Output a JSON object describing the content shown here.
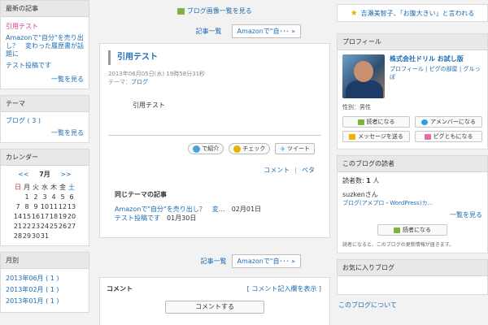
{
  "left": {
    "recent": {
      "header": "最新の記事",
      "items": [
        {
          "label": "引用テスト",
          "active": true
        },
        {
          "label": "Amazonで\"自分\"を売り出し？　変わった履歴書が話題に",
          "active": false
        },
        {
          "label": "テスト投稿です",
          "active": false
        }
      ],
      "more": "一覧を見る"
    },
    "theme": {
      "header": "テーマ",
      "item": "ブログ ( 3 )",
      "more": "一覧を見る"
    },
    "calendar": {
      "header": "カレンダー",
      "prev": "<<",
      "month": "7月",
      "next": ">>",
      "weekdays": [
        "日",
        "月",
        "火",
        "水",
        "木",
        "金",
        "土"
      ],
      "rows": [
        [
          "",
          "1",
          "2",
          "3",
          "4",
          "5",
          "6"
        ],
        [
          "7",
          "8",
          "9",
          "10",
          "11",
          "12",
          "13"
        ],
        [
          "14",
          "15",
          "16",
          "17",
          "18",
          "19",
          "20"
        ],
        [
          "21",
          "22",
          "23",
          "24",
          "25",
          "26",
          "27"
        ],
        [
          "28",
          "29",
          "30",
          "31",
          "",
          "",
          ""
        ]
      ]
    },
    "monthly": {
      "header": "月別",
      "items": [
        "2013年06月 ( 1 )",
        "2013年02月 ( 1 )",
        "2013年01月 ( 1 )"
      ]
    }
  },
  "center": {
    "top_link": "ブログ画像一覧を見る",
    "pager": {
      "list": "記事一覧",
      "next": "Amazonで\"自･･･ »"
    },
    "article": {
      "title": "引用テスト",
      "date": "2013年06月05日(水) 19時58分31秒",
      "theme_label": "テーマ：",
      "theme": "ブログ",
      "body": "引用テスト",
      "share": {
        "intro": "で紹介",
        "check": "チェック",
        "tweet": "ツイート"
      },
      "comment_link": "コメント",
      "sep": "|",
      "peta_link": "ペタ",
      "same_theme_header": "同じテーマの記事",
      "same_theme": [
        {
          "title": "Amazonで\"自分\"を売り出し？　変…",
          "date": "02月01日"
        },
        {
          "title": "テスト投稿です",
          "date": "01月30日"
        }
      ]
    },
    "comments": {
      "header": "コメント",
      "write_link": "[ コメント記入欄を表示 ]",
      "button": "コメントする"
    }
  },
  "right": {
    "cheer": "吉瀬美智子、「お腹大きい」と言われる",
    "profile": {
      "header": "プロフィール",
      "name": "株式会社ドリル お試し版",
      "links": "プロフィール | ピグの部屋 | グルっぽ",
      "gender": "性別：男性",
      "buttons": [
        "読者になる",
        "アメンバーになる",
        "メッセージを送る",
        "ピグともになる"
      ]
    },
    "readers": {
      "header": "このブログの読者",
      "count_label": "読者数:",
      "count": "1",
      "count_suffix": "人",
      "name": "suzkenさん",
      "blog": "ブログ(アメプロ・WordPress)カ…",
      "more": "一覧を見る",
      "button": "読者になる",
      "note": "読者になると、このブログの更新情報が届きます。"
    },
    "favorites": {
      "header": "お気に入りブログ"
    },
    "about": "このブログについて"
  },
  "colors": {
    "link": "#1d6cb3",
    "active": "#d23b8f",
    "header_bg": "#e8e8e8"
  }
}
